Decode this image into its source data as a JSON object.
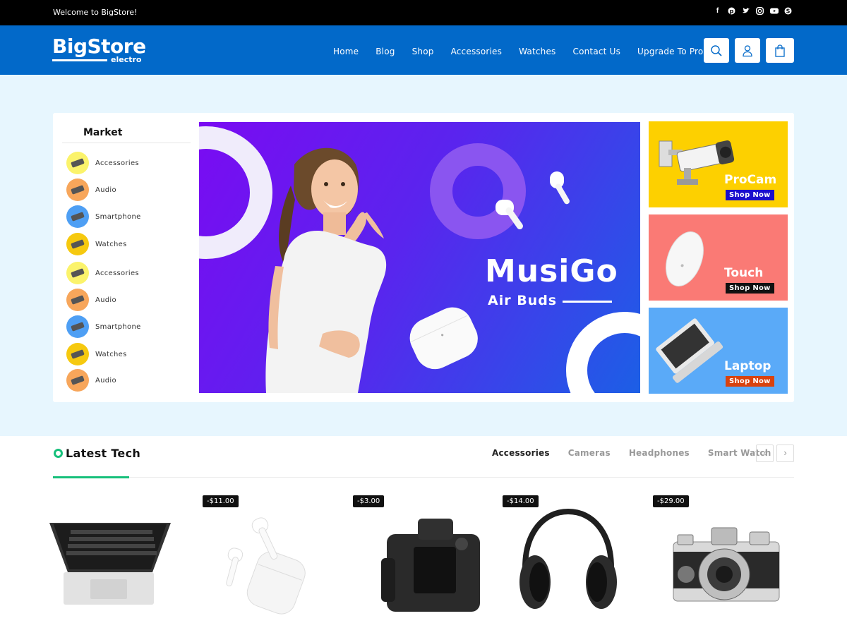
{
  "topbar": {
    "welcome": "Welcome to BigStore!",
    "social_icons": [
      "facebook-icon",
      "pinterest-icon",
      "twitter-icon",
      "instagram-icon",
      "youtube-icon",
      "skype-icon"
    ]
  },
  "header": {
    "logo_main": "BigStore",
    "logo_sub": "electro",
    "nav": [
      "Home",
      "Blog",
      "Shop",
      "Accessories",
      "Watches",
      "Contact Us",
      "Upgrade To Pro"
    ],
    "icons": [
      "search-icon",
      "user-icon",
      "cart-icon"
    ]
  },
  "market": {
    "title": "Market",
    "items": [
      {
        "label": "Accessories",
        "color": "#fbf36b"
      },
      {
        "label": "Audio",
        "color": "#f7a65b"
      },
      {
        "label": "Smartphone",
        "color": "#4e9ff4"
      },
      {
        "label": "Watches",
        "color": "#f6c90f"
      },
      {
        "label": "Accessories",
        "color": "#fbf36b"
      },
      {
        "label": "Audio",
        "color": "#f7a65b"
      },
      {
        "label": "Smartphone",
        "color": "#4e9ff4"
      },
      {
        "label": "Watches",
        "color": "#f6c90f"
      },
      {
        "label": "Audio",
        "color": "#f7a65b"
      }
    ]
  },
  "banner": {
    "title": "MusiGo",
    "subtitle": "Air Buds"
  },
  "side_banners": [
    {
      "name": "ProCam",
      "shop": "Shop Now",
      "bg": "#fdd000",
      "btn": "#1b0fcc"
    },
    {
      "name": "Touch",
      "shop": "Shop Now",
      "bg": "#fa7a75",
      "btn": "#111111"
    },
    {
      "name": "Laptop",
      "shop": "Shop Now",
      "bg": "#5aaaf8",
      "btn": "#d9420e"
    }
  ],
  "latest": {
    "title": "Latest Tech",
    "tabs": [
      "Accessories",
      "Cameras",
      "Headphones",
      "Smart Watch"
    ],
    "active_tab": "Accessories",
    "prev": "‹",
    "next": "›",
    "products": [
      {
        "name": "laptop",
        "badge": ""
      },
      {
        "name": "earbuds",
        "badge": "-$11.00"
      },
      {
        "name": "dslr-camera",
        "badge": "-$3.00"
      },
      {
        "name": "headphones",
        "badge": "-$14.00"
      },
      {
        "name": "vintage-camera",
        "badge": "-$29.00"
      }
    ]
  },
  "colors": {
    "header": "#0269c9",
    "hero_bg": "#e7f6fe",
    "accent": "#16c07b"
  }
}
